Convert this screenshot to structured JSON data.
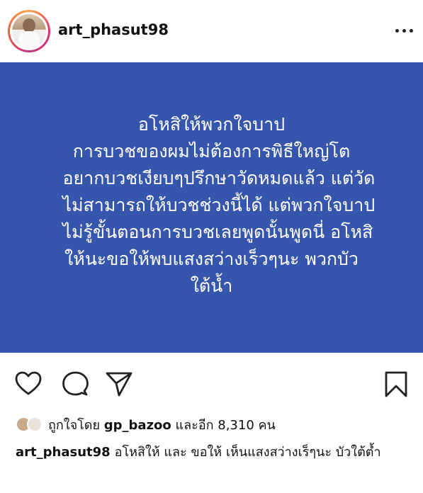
{
  "post": {
    "username": "art_phasut98",
    "text_lines": [
      "อโหสิให้พวกใจบาป",
      "การบวชของผมไม่ต้องการพิธีใหญ่โต",
      "อยากบวชเงียบๆปรึกษาวัดหมดแล้ว แต่วัด",
      "ไม่สามารถให้บวชช่วงนี้ได้ แต่พวกใจบาป",
      "ไม่รู้ขั้นตอนการบวชเลยพูดนั้นพูดนี่ อโหสิ",
      "ให้นะขอให้พบแสงสว่างเร็วๆนะ พวกบัว",
      "ใต้น้ำ"
    ],
    "background_color": "#3656ad"
  },
  "likes": {
    "prefix": "ถูกใจโดย",
    "user": "gp_bazoo",
    "suffix": "และอีก 8,310 คน"
  },
  "caption": {
    "username": "art_phasut98",
    "text": "อโหสิให้ และ ขอให้ เห็นแสงสว่างเร็ๆนะ บัวใต้ต้ำ"
  },
  "icons": [
    "heart-icon",
    "comment-icon",
    "share-icon",
    "bookmark-icon",
    "more-icon"
  ]
}
